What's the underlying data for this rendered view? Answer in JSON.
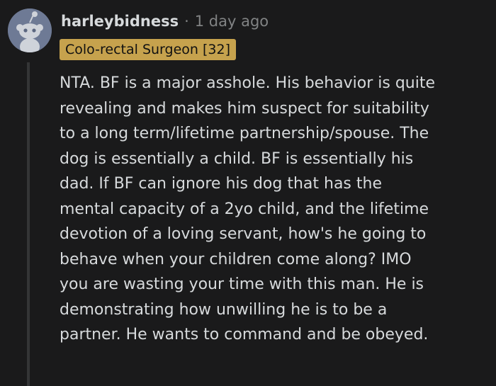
{
  "comment": {
    "username": "harleybidness",
    "separator": "·",
    "time": "1 day ago",
    "flair": "Colo-rectal Surgeon [32]",
    "body_lines": [
      "NTA. BF is a major asshole. His behavior is quite",
      "revealing and makes him suspect for suitability",
      "to a long term/lifetime partnership/spouse. The",
      "dog is essentially a child. BF is essentially his",
      "dad. If BF can ignore his dog that has the",
      "mental capacity of a 2yo child, and the lifetime",
      "devotion of a loving servant, how's he going to",
      "behave when your children come along? IMO",
      "you are wasting your time with this man. He is",
      "demonstrating how unwilling he is to be a",
      "partner. He wants to command and be obeyed."
    ],
    "avatar_icon": "snoo-avatar-icon",
    "colors": {
      "background": "#1a1a1b",
      "flair_bg": "#c6a24d",
      "avatar_bg": "#6e7a95",
      "text": "#d7dadc",
      "muted": "#818384"
    }
  }
}
